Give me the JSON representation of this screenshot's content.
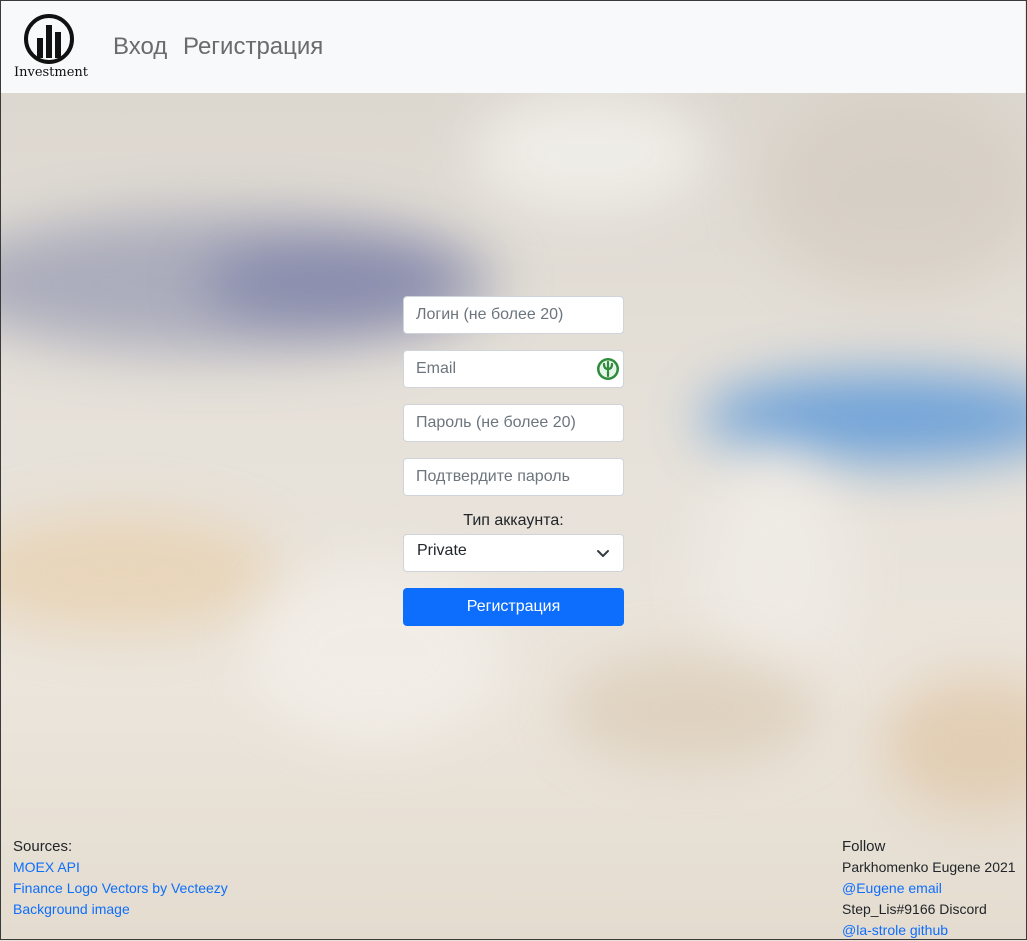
{
  "header": {
    "logo_text": "Investment",
    "nav": {
      "login": "Вход",
      "register": "Регистрация"
    }
  },
  "form": {
    "login_placeholder": "Логин (не более 20)",
    "email_placeholder": "Email",
    "password_placeholder": "Пароль (не более 20)",
    "confirm_placeholder": "Подтвердите пароль",
    "account_type_label": "Тип аккаунта:",
    "account_type_value": "Private",
    "submit_label": "Регистрация"
  },
  "footer": {
    "sources_title": "Sources:",
    "sources": [
      "MOEX API",
      "Finance Logo Vectors by Vecteezy",
      "Background image"
    ],
    "follow_title": "Follow",
    "author": "Parkhomenko Eugene 2021",
    "email_link": "@Eugene email",
    "discord": "Step_Lis#9166 Discord",
    "github_link": "@la-strole github"
  },
  "colors": {
    "primary": "#0d6efd",
    "navbar_bg": "#f8f9fa"
  },
  "icons": {
    "logo": "bar-chart-circle-icon",
    "email_extension": "password-manager-icon",
    "select": "chevron-down-icon"
  }
}
